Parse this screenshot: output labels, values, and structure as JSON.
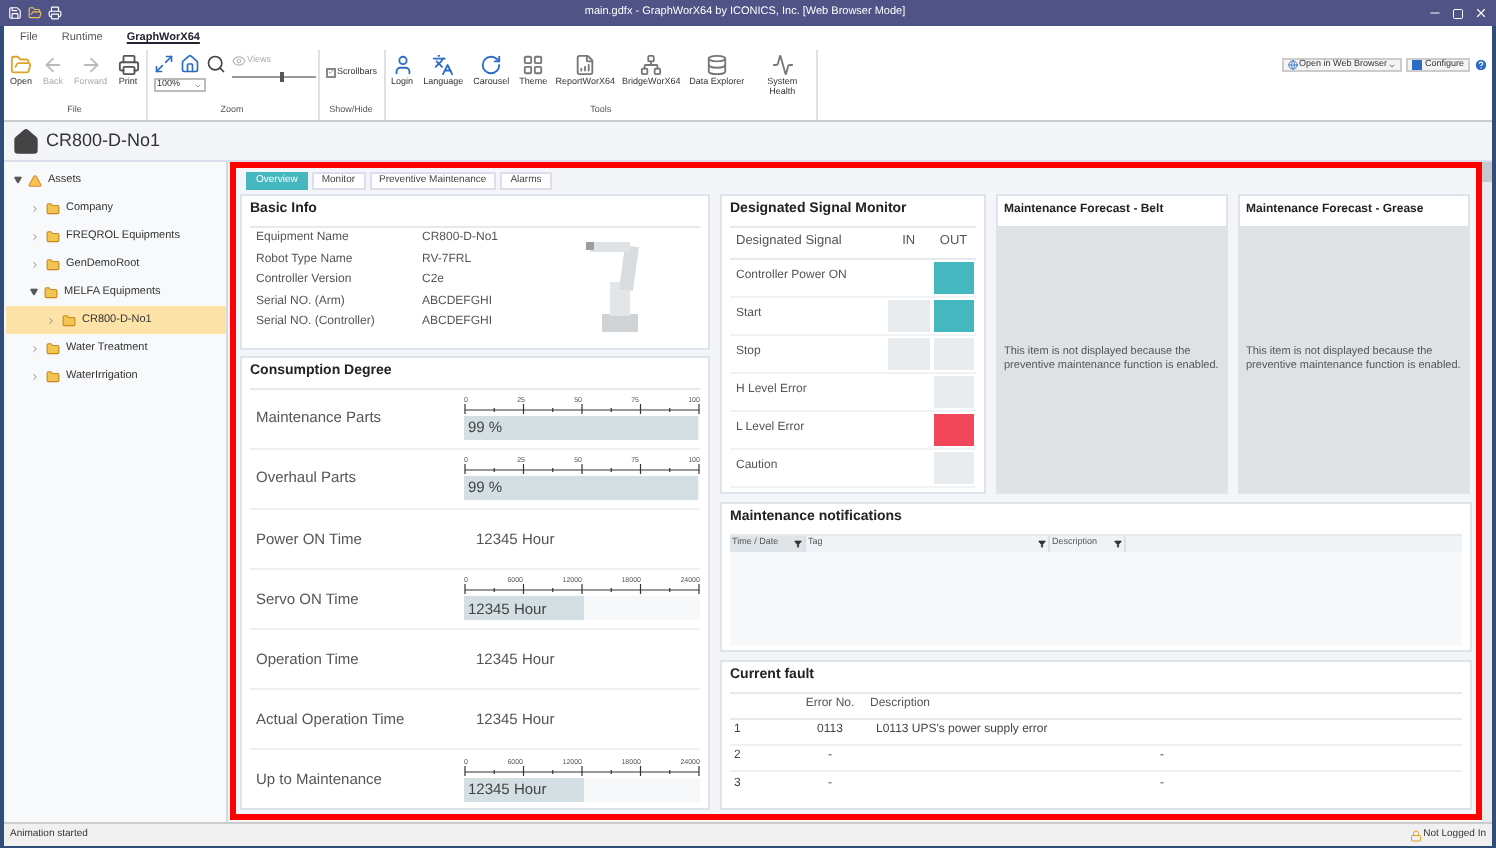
{
  "window": {
    "title": "main.gdfx - GraphWorX64 by ICONICS, Inc. [Web Browser Mode]"
  },
  "menu_tabs": [
    {
      "label": "File",
      "selected": false
    },
    {
      "label": "Runtime",
      "selected": false
    },
    {
      "label": "GraphWorX64",
      "selected": true
    }
  ],
  "ribbon": {
    "file_group": {
      "label": "File",
      "buttons": [
        {
          "label": "Open",
          "disabled": false
        },
        {
          "label": "Back",
          "disabled": true
        },
        {
          "label": "Forward",
          "disabled": true
        },
        {
          "label": "Print",
          "disabled": false
        }
      ]
    },
    "zoom_group": {
      "label": "Zoom",
      "zoom_value": "100%",
      "views": {
        "label": "Views",
        "disabled": true
      },
      "level": 0.6
    },
    "show_hide_group": {
      "label": "Show/Hide",
      "checkbox": {
        "label": "Scrollbars",
        "checked": true
      }
    },
    "tools_group": {
      "label": "Tools",
      "buttons": [
        {
          "label": "Login"
        },
        {
          "label": "Language"
        },
        {
          "label": "Carousel"
        },
        {
          "label": "Theme"
        },
        {
          "label": "ReportWorX64"
        },
        {
          "label": "BridgeWorX64"
        },
        {
          "label": "Data Explorer"
        },
        {
          "label": "System Health"
        }
      ]
    },
    "open_in_browser": "Open in Web Browser",
    "configure": "Configure"
  },
  "header": {
    "title": "CR800-D-No1"
  },
  "tree": [
    {
      "label": "Assets",
      "expanded": true,
      "selected": false,
      "children": [
        {
          "label": "Company",
          "expanded": false,
          "selected": false
        },
        {
          "label": "FREQROL Equipments",
          "expanded": false,
          "selected": false
        },
        {
          "label": "GenDemoRoot",
          "expanded": false,
          "selected": false
        },
        {
          "label": "MELFA Equipments",
          "expanded": true,
          "selected": false,
          "children": [
            {
              "label": "CR800-D-No1",
              "expanded": false,
              "selected": true
            }
          ]
        },
        {
          "label": "Water Treatment",
          "expanded": false,
          "selected": false
        },
        {
          "label": "WaterIrrigation",
          "expanded": false,
          "selected": false
        }
      ]
    }
  ],
  "content_tabs": [
    {
      "label": "Overview",
      "selected": true
    },
    {
      "label": "Monitor",
      "selected": false
    },
    {
      "label": "Preventive Maintenance",
      "selected": false
    },
    {
      "label": "Alarms",
      "selected": false
    }
  ],
  "basic_info": {
    "title": "Basic Info",
    "rows": [
      {
        "label": "Equipment Name",
        "value": "CR800-D-No1"
      },
      {
        "label": "Robot Type Name",
        "value": "RV-7FRL"
      },
      {
        "label": "Controller Version",
        "value": "C2e"
      },
      {
        "label": "Serial NO. (Arm)",
        "value": "ABCDEFGHI"
      },
      {
        "label": "Serial NO. (Controller)",
        "value": "ABCDEFGHI"
      }
    ]
  },
  "consumption": {
    "title": "Consumption Degree",
    "rows": [
      {
        "kind": "gauge",
        "label": "Maintenance Parts",
        "reading": "99 %",
        "level": 0.99,
        "ticks": [
          "0",
          "25",
          "50",
          "75",
          "100"
        ]
      },
      {
        "kind": "gauge",
        "label": "Overhaul Parts",
        "reading": "99 %",
        "level": 0.99,
        "ticks": [
          "0",
          "25",
          "50",
          "75",
          "100"
        ]
      },
      {
        "kind": "text",
        "label": "Power ON Time",
        "reading": "12345 Hour"
      },
      {
        "kind": "gauge",
        "label": "Servo ON Time",
        "reading": "12345 Hour",
        "level": 0.51,
        "ticks": [
          "0",
          "6000",
          "12000",
          "18000",
          "24000"
        ]
      },
      {
        "kind": "text",
        "label": "Operation Time",
        "reading": "12345 Hour"
      },
      {
        "kind": "text",
        "label": "Actual Operation Time",
        "reading": "12345 Hour"
      },
      {
        "kind": "gauge",
        "label": "Up to Maintenance",
        "reading": "12345 Hour",
        "level": 0.51,
        "ticks": [
          "0",
          "6000",
          "12000",
          "18000",
          "24000"
        ]
      }
    ]
  },
  "signal_monitor": {
    "title": "Designated Signal Monitor",
    "columns": [
      "Designated Signal",
      "IN",
      "OUT"
    ],
    "rows": [
      {
        "label": "Controller Power ON",
        "out": {
          "color": "#45b8bf"
        }
      },
      {
        "label": "Start",
        "in": {
          "color": "#e8ecef"
        },
        "out": {
          "color": "#45b8bf"
        }
      },
      {
        "label": "Stop",
        "in": {
          "color": "#e8ecef"
        },
        "out": {
          "color": "#e8ecef"
        }
      },
      {
        "label": "H Level Error",
        "out": {
          "color": "#e8ecef"
        }
      },
      {
        "label": "L Level Error",
        "out": {
          "color": "#f2465a"
        }
      },
      {
        "label": "Caution",
        "out": {
          "color": "#e8ecef"
        }
      }
    ]
  },
  "forecasts": [
    {
      "title": "Maintenance Forecast - Belt",
      "message": "This item is not displayed because the preventive maintenance function is enabled."
    },
    {
      "title": "Maintenance Forecast - Grease",
      "message": "This item is not displayed because the preventive maintenance function is enabled."
    }
  ],
  "notifications": {
    "title": "Maintenance notifications",
    "columns": [
      {
        "label": "Time / Date",
        "selected": true
      },
      {
        "label": "Tag",
        "selected": false
      },
      {
        "label": "Description",
        "selected": false
      }
    ]
  },
  "current_fault": {
    "title": "Current fault",
    "columns": [
      "Error No.",
      "Description"
    ],
    "rows": [
      {
        "index": "1",
        "error_no": "0113",
        "description": "L0113 UPS's power supply error"
      },
      {
        "index": "2",
        "error_no": "-",
        "description": "-"
      },
      {
        "index": "3",
        "error_no": "-",
        "description": "-"
      }
    ]
  },
  "status_bar": {
    "message": "Animation started",
    "login": "Not Logged In"
  }
}
